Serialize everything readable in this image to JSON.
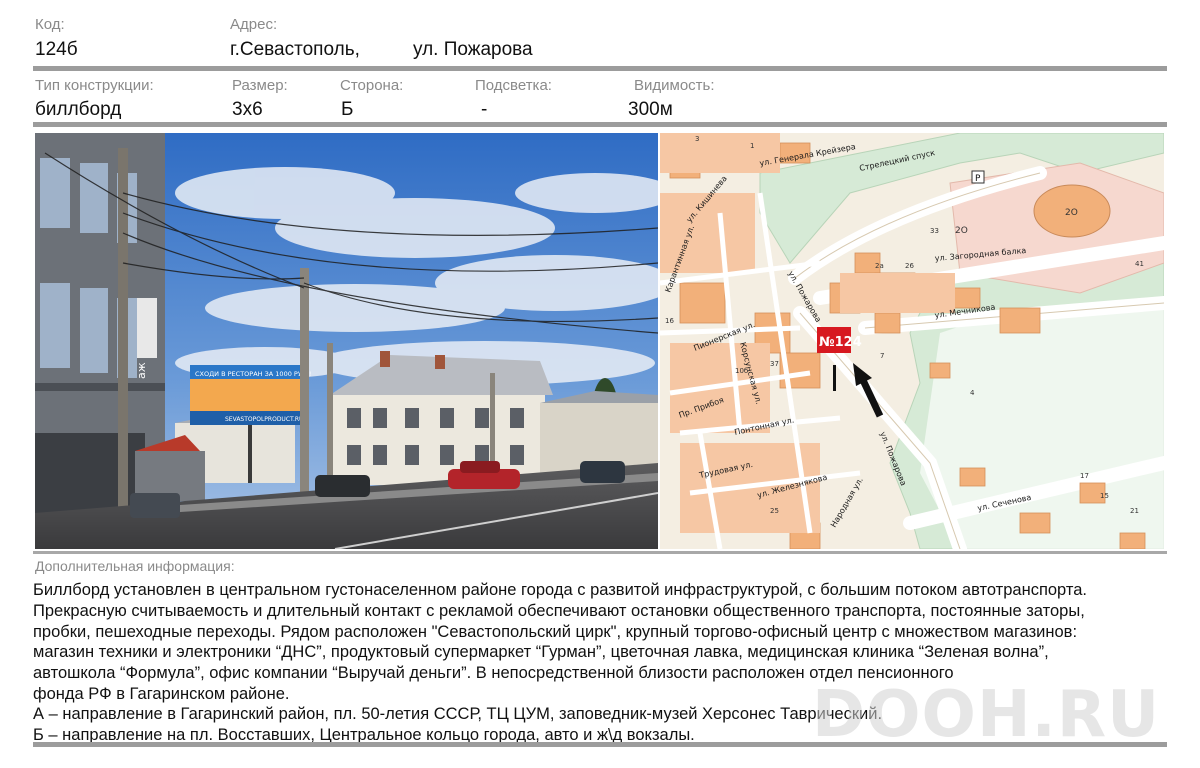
{
  "header": {
    "code_label": "Код:",
    "code_value": "124б",
    "address_label": "Адрес:",
    "address_city": "г.Севастополь,",
    "address_street": "ул. Пожарова"
  },
  "specs": {
    "type_label": "Тип конструкции:",
    "type_value": "биллборд",
    "size_label": "Размер:",
    "size_value": "3х6",
    "side_label": "Сторона:",
    "side_value": "Б",
    "light_label": "Подсветка:",
    "light_value": "-",
    "visibility_label": "Видимость:",
    "visibility_value": "300м"
  },
  "photo": {
    "billboard_line1": "СХОДИ В РЕСТОРАН ЗА 1000 РУБ!!",
    "billboard_line2": "SEVASTOPOLPRODUCT.RU",
    "shop_sign": "аж"
  },
  "map": {
    "marker_label": "№124",
    "streets": [
      "ул. Генерала Крейзера",
      "Стрелецкий спуск",
      "ул. Загородная балка",
      "ул. Мечникова",
      "ул. Пожарова",
      "Карантинная ул.",
      "Пионерская ул.",
      "Корсунская ул.",
      "Понтонная ул.",
      "Трудовая ул.",
      "ул. Железнякова",
      "ул. Сеченова",
      "Народная ул.",
      "ул. Кишинева",
      "Пр. Прибоя",
      "ул. Пожарова"
    ],
    "numbers": [
      "33",
      "2O",
      "2O",
      "4",
      "7",
      "37",
      "25",
      "41",
      "17",
      "15",
      "21",
      "3",
      "1",
      "16",
      "2а",
      "26",
      "10б"
    ]
  },
  "info": {
    "label": "Дополнительная информация:",
    "lines": [
      "Биллборд  установлен в центральном густонаселенном районе города с развитой инфраструктурой, с большим потоком автотранспорта.",
      "Прекрасную считываемость и длительный контакт с рекламой обеспечивают остановки общественного транспорта, постоянные заторы,",
      "пробки, пешеходные переходы. Рядом расположен  \"Севастопольский цирк\", крупный торгово-офисный центр с множеством магазинов:",
      "магазин техники и электроники “ДНС”, продуктовый супермаркет “Гурман”, цветочная лавка, медицинская клиника “Зеленая волна”,",
      "автошкола “Формула”,  офис  компании “Выручай деньги”. В непосредственной близости расположен отдел пенсионного",
      "фонда РФ в Гагаринском районе.",
      "А – направление в Гагаринский район, пл. 50-летия СССР, ТЦ ЦУМ, заповедник-музей Херсонес Таврический.",
      "Б – направление на пл. Восставших, Центральное кольцо города, авто и ж\\д вокзалы."
    ]
  },
  "watermark": "DOOH.RU"
}
